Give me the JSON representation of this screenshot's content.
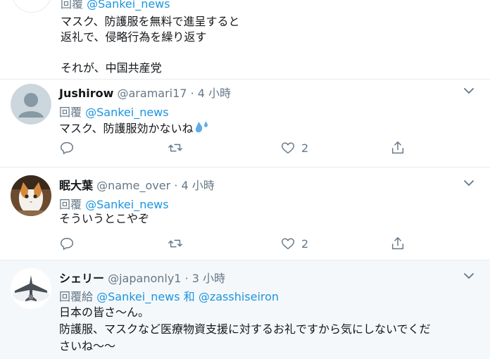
{
  "top_tweet": {
    "reply_prefix": "回覆",
    "reply_handle": "@Sankei_news",
    "lines": [
      "マスク、防護服を無料で進呈すると",
      "返礼で、侵略行為を繰り返す",
      "",
      "それが、中国共産党"
    ]
  },
  "tweets": [
    {
      "name": "Jushirow",
      "handle": "@aramari17",
      "sep": "·",
      "time": "4 小時",
      "reply_prefix": "回覆",
      "reply_to": "@Sankei_news",
      "text": "マスク、防護服効かないね",
      "emoji": "sweat-droplets",
      "like_count": "2",
      "avatar": "default-avatar"
    },
    {
      "name": "眠大葉",
      "handle": "@name_over",
      "sep": "·",
      "time": "4 小時",
      "reply_prefix": "回覆",
      "reply_to": "@Sankei_news",
      "text": "そういうとこやぞ",
      "like_count": "2",
      "avatar": "cat-photo"
    },
    {
      "name": "シェリー",
      "handle": "@japanonly1",
      "sep": "·",
      "time": "3 小時",
      "reply_prefix": "回覆給",
      "reply_to": "@Sankei_news",
      "reply_and": "和",
      "reply_to_2": "@zasshiseiron",
      "text_lines": [
        "日本の皆さ〜ん。",
        "防護服、マスクなど医療物資支援に対するお礼ですから気にしないでくだ",
        "さいね〜〜"
      ],
      "avatar": "jet-photo"
    }
  ],
  "colors": {
    "link": "#1b95e0",
    "muted": "#657786",
    "highlight_bg": "#f5f8fa"
  }
}
